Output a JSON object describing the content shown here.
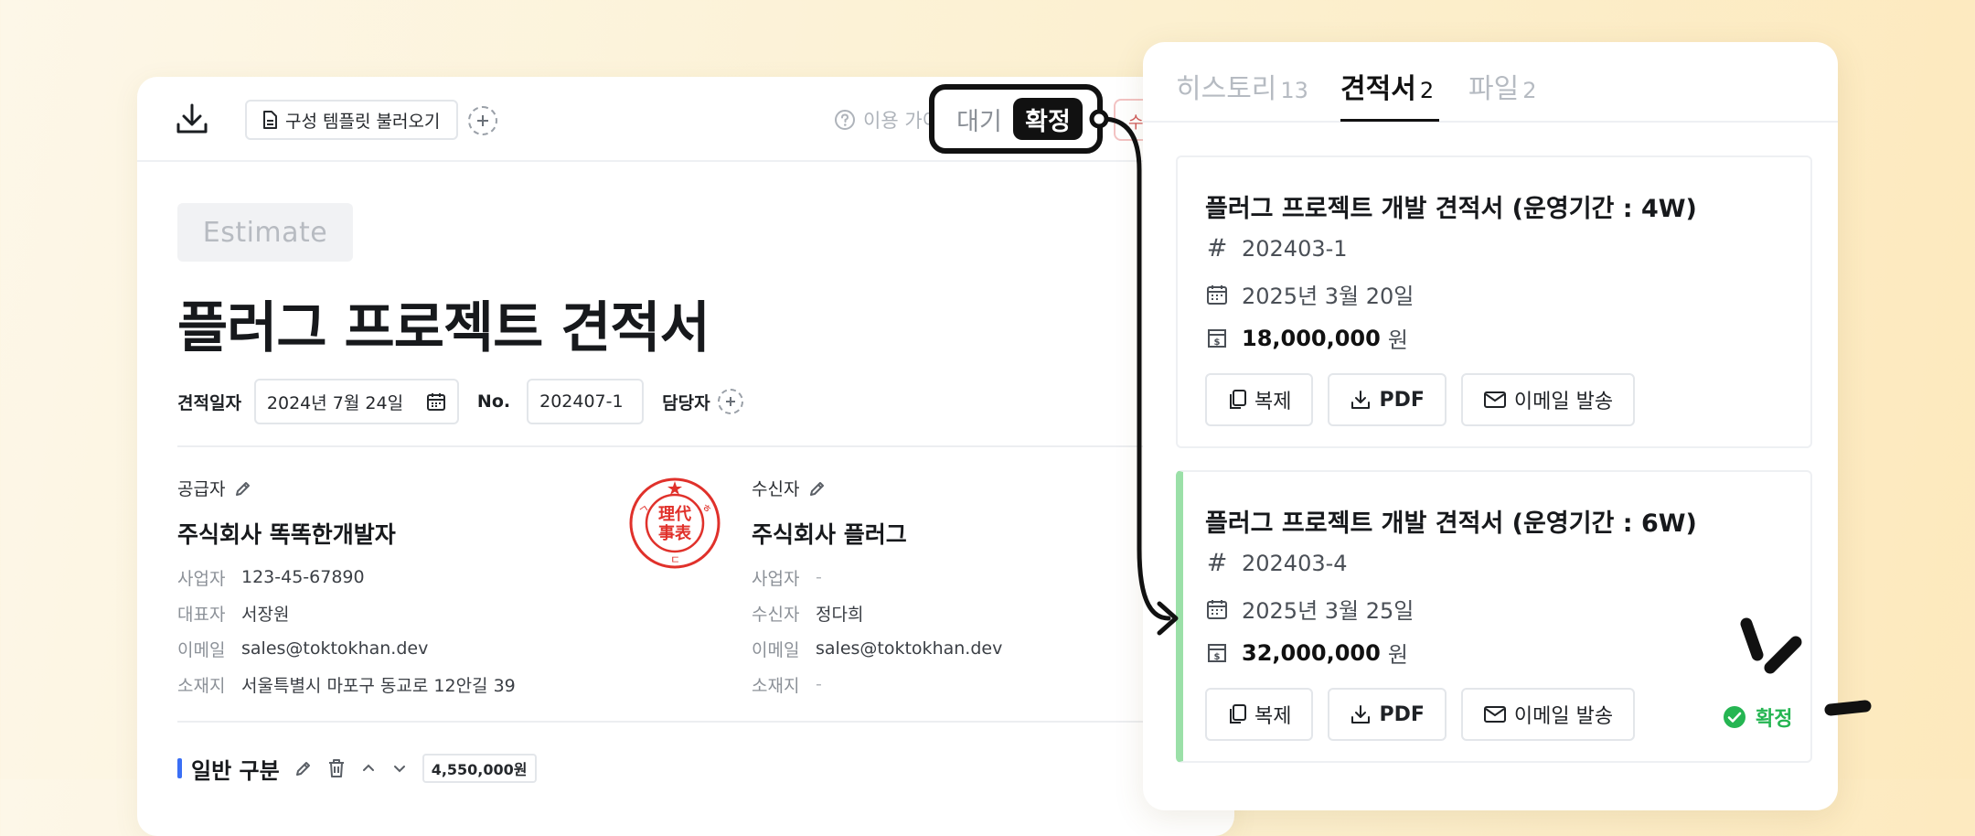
{
  "editor": {
    "toolbar": {
      "template_label": "구성 템플릿 불러오기",
      "guide_label": "이용 가이드",
      "right_button_label": "수"
    },
    "badge": "Estimate",
    "title": "플러그 프로젝트 견적서",
    "meta": {
      "date_label": "견적일자",
      "date_value": "2024년 7월 24일",
      "no_label": "No.",
      "no_value": "202407-1",
      "manager_label": "담당자"
    },
    "supplier": {
      "label": "공급자",
      "name": "주식회사 똑똑한개발자",
      "rows": [
        {
          "k": "사업자",
          "v": "123-45-67890"
        },
        {
          "k": "대표자",
          "v": "서장원"
        },
        {
          "k": "이메일",
          "v": "sales@toktokhan.dev"
        },
        {
          "k": "소재지",
          "v": "서울특별시 마포구 동교로 12안길 39"
        }
      ]
    },
    "receiver": {
      "label": "수신자",
      "name": "주식회사 플러그",
      "rows": [
        {
          "k": "사업자",
          "v": "-"
        },
        {
          "k": "수신자",
          "v": "정다희"
        },
        {
          "k": "이메일",
          "v": "sales@toktokhan.dev"
        },
        {
          "k": "소재지",
          "v": "-"
        }
      ]
    },
    "seal_text": [
      "理代",
      "事表",
      "ㄱ",
      "ㅎ",
      "ㄷ"
    ],
    "section": {
      "title": "일반 구분",
      "amount": "4,550,000원"
    }
  },
  "toggle": {
    "wait": "대기",
    "confirm": "확정",
    "selected": "confirm"
  },
  "panel": {
    "tabs": [
      {
        "label": "히스토리",
        "count": "13"
      },
      {
        "label": "견적서",
        "count": "2"
      },
      {
        "label": "파일",
        "count": "2"
      }
    ],
    "active_tab": 1,
    "quotes": [
      {
        "title": "플러그 프로젝트 개발 견적서 (운영기간 : 4W)",
        "number": "202403-1",
        "date": "2025년 3월 20일",
        "amount": "18,000,000",
        "unit": "원",
        "status": ""
      },
      {
        "title": "플러그 프로젝트 개발 견적서 (운영기간 : 6W)",
        "number": "202403-4",
        "date": "2025년 3월 25일",
        "amount": "32,000,000",
        "unit": "원",
        "status": "확정"
      }
    ],
    "actions": {
      "copy": "복제",
      "pdf": "PDF",
      "email": "이메일 발송"
    }
  },
  "colors": {
    "accent_blue": "#3b6ff5",
    "confirmed_green": "#25b552",
    "confirmed_bar": "#9be0a8",
    "seal_red": "#e0312b"
  }
}
